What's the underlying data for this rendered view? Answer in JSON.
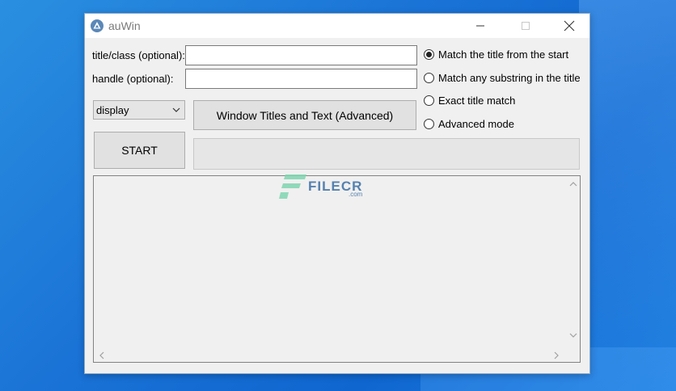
{
  "window": {
    "title": "auWin"
  },
  "form": {
    "title_label": "title/class (optional):",
    "title_value": "",
    "handle_label": "handle (optional):",
    "handle_value": "",
    "display_select": "display",
    "advanced_button": "Window Titles and Text (Advanced)",
    "start_button": "START",
    "status_text": ""
  },
  "match_options": [
    {
      "label": "Match the title from the start",
      "selected": true
    },
    {
      "label": "Match any substring in the title",
      "selected": false
    },
    {
      "label": "Exact title match",
      "selected": false
    },
    {
      "label": "Advanced mode",
      "selected": false
    }
  ],
  "output": {
    "text": ""
  },
  "watermark": {
    "name": "FILECR",
    "suffix": ".com"
  },
  "colors": {
    "desktop": "#1a73d6",
    "window_bg": "#f0f0f0",
    "button_bg": "#e1e1e1",
    "watermark": "#3a6ea5"
  },
  "icons": {
    "app": "autoit-icon",
    "minimize": "minimize-icon",
    "maximize": "maximize-icon",
    "close": "close-icon",
    "dropdown": "chevron-down-icon"
  }
}
